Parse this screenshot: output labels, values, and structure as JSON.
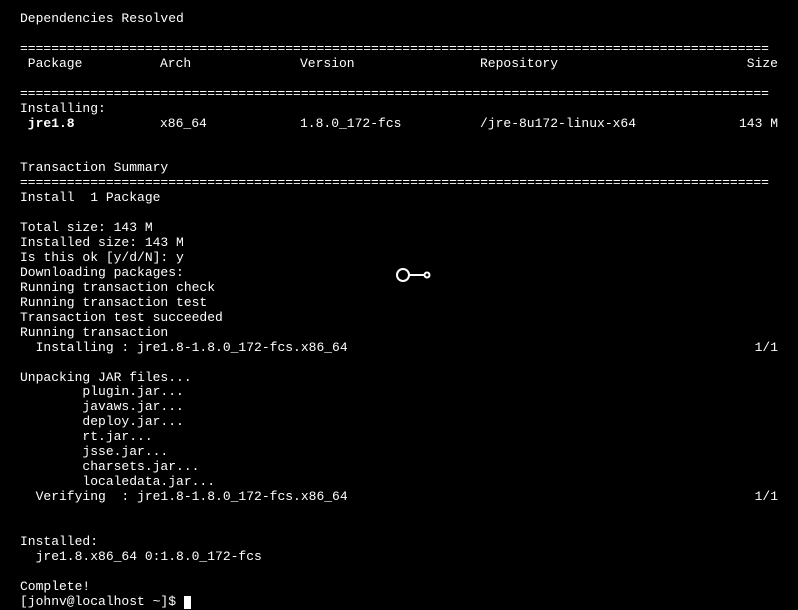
{
  "header": "Dependencies Resolved",
  "blank": "",
  "divider": "================================================================================================",
  "cols": {
    "pkg": " Package",
    "arch": "Arch",
    "ver": "Version",
    "repo": "Repository",
    "size": "Size"
  },
  "installing_label": "Installing:",
  "pkg": {
    "name": " jre1.8",
    "arch": "x86_64",
    "ver": "1.8.0_172-fcs",
    "repo": "/jre-8u172-linux-x64",
    "size": "143 M"
  },
  "transaction_summary_label": "Transaction Summary",
  "install_count": "Install  1 Package",
  "total_size": "Total size: 143 M",
  "installed_size": "Installed size: 143 M",
  "confirm": "Is this ok [y/d/N]: y",
  "downloading": "Downloading packages:",
  "check": "Running transaction check",
  "test": "Running transaction test",
  "test_ok": "Transaction test succeeded",
  "running": "Running transaction",
  "install_step": {
    "left": "  Installing : jre1.8-1.8.0_172-fcs.x86_64",
    "right": "1/1"
  },
  "unpacking": "Unpacking JAR files...",
  "jars": [
    "        plugin.jar...",
    "        javaws.jar...",
    "        deploy.jar...",
    "        rt.jar...",
    "        jsse.jar...",
    "        charsets.jar...",
    "        localedata.jar..."
  ],
  "verify_step": {
    "left": "  Verifying  : jre1.8-1.8.0_172-fcs.x86_64",
    "right": "1/1"
  },
  "installed_label": "Installed:",
  "installed_pkg": "  jre1.8.x86_64 0:1.8.0_172-fcs",
  "complete": "Complete!",
  "prompt": "[johnv@localhost ~]$ "
}
